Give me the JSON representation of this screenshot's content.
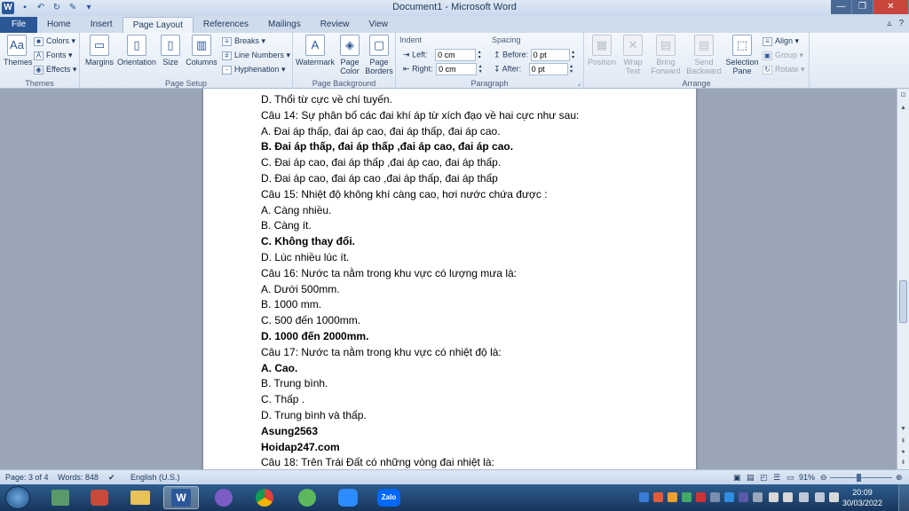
{
  "window": {
    "title": "Document1 - Microsoft Word"
  },
  "tabs": [
    "File",
    "Home",
    "Insert",
    "Page Layout",
    "References",
    "Mailings",
    "Review",
    "View"
  ],
  "active_tab": "Page Layout",
  "ribbon": {
    "themes": {
      "themes_label": "Themes",
      "colors_label": "Colors",
      "fonts_label": "Fonts",
      "effects_label": "Effects",
      "group_label": "Themes"
    },
    "page_setup": {
      "margins_label": "Margins",
      "orientation_label": "Orientation",
      "size_label": "Size",
      "columns_label": "Columns",
      "breaks_label": "Breaks",
      "line_numbers_label": "Line Numbers",
      "hyphenation_label": "Hyphenation",
      "group_label": "Page Setup"
    },
    "page_background": {
      "watermark_label": "Watermark",
      "page_color_label_1": "Page",
      "page_color_label_2": "Color",
      "page_borders_label_1": "Page",
      "page_borders_label_2": "Borders",
      "group_label": "Page Background"
    },
    "paragraph": {
      "indent_label": "Indent",
      "left_label": "Left:",
      "left_value": "0 cm",
      "right_label": "Right:",
      "right_value": "0 cm",
      "spacing_label": "Spacing",
      "before_label": "Before:",
      "before_value": "0 pt",
      "after_label": "After:",
      "after_value": "0 pt",
      "group_label": "Paragraph"
    },
    "arrange": {
      "position_label": "Position",
      "wrap_text_label_1": "Wrap",
      "wrap_text_label_2": "Text",
      "bring_forward_label_1": "Bring",
      "bring_forward_label_2": "Forward",
      "send_backward_label_1": "Send",
      "send_backward_label_2": "Backward",
      "selection_pane_label_1": "Selection",
      "selection_pane_label_2": "Pane",
      "align_label": "Align",
      "group_label_btn": "Group",
      "rotate_label": "Rotate",
      "group_label": "Arrange"
    }
  },
  "document": {
    "lines": [
      {
        "text": "D. Thổi từ cực về chí tuyến.",
        "bold": false
      },
      {
        "text": "Câu 14: Sự phân bố các đai khí áp từ xích đạo về hai cực như sau:",
        "bold": false
      },
      {
        "text": "A. Đai áp thấp, đai áp cao, đai áp thấp, đai áp cao.",
        "bold": false
      },
      {
        "text": " B. Đai áp thấp, đai áp thấp ,đai áp cao, đai áp cao.",
        "bold": true
      },
      {
        "text": "C. Đai áp cao, đai áp thấp ,đai áp cao, đai áp thấp.",
        "bold": false
      },
      {
        "text": " D. Đai áp cao, đai áp cao ,đai áp thấp, đai áp thấp",
        "bold": false
      },
      {
        "text": "Câu 15: Nhiệt độ không khí càng cao, hơi nước chứa được :",
        "bold": false
      },
      {
        "text": "A. Càng nhiều.",
        "bold": false
      },
      {
        "text": "B. Càng ít.",
        "bold": false
      },
      {
        "text": " C. Không thay đổi.",
        "bold": true
      },
      {
        "text": " D. Lúc nhiều lúc ít.",
        "bold": false
      },
      {
        "text": "Câu 16: Nước ta nằm trong khu vực có lượng mưa là:",
        "bold": false
      },
      {
        "text": "A. Dưới 500mm.",
        "bold": false
      },
      {
        "text": " B. 1000 mm.",
        "bold": false
      },
      {
        "text": "C. 500 đến 1000mm.",
        "bold": false
      },
      {
        "text": "D. 1000 đến 2000mm.",
        "bold": true
      },
      {
        "text": "Câu 17: Nước ta nằm trong khu vực có nhiệt độ là:",
        "bold": false
      },
      {
        "text": " A. Cao.",
        "bold": true
      },
      {
        "text": "B. Trung bình.",
        "bold": false
      },
      {
        "text": "C. Thấp .",
        "bold": false
      },
      {
        "text": "D. Trung bình và thấp.",
        "bold": false
      },
      {
        "text": "Asung2563",
        "bold": true
      },
      {
        "text": "Hoidap247.com",
        "bold": true
      },
      {
        "text": " Câu 18: Trên Trái Đất có những vòng đai nhiệt là:",
        "bold": false
      }
    ]
  },
  "statusbar": {
    "page": "Page: 3 of 4",
    "words": "Words: 848",
    "language": "English (U.S.)",
    "zoom": "91%",
    "zoom_fraction": 0.45
  },
  "taskbar": {
    "apps": [
      "W",
      "Zalo"
    ],
    "time": "20:09",
    "date": "30/03/2022"
  }
}
